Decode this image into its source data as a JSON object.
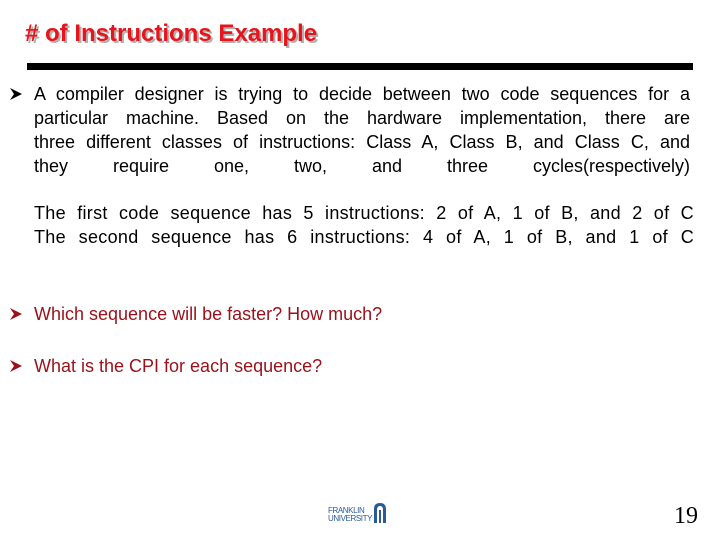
{
  "slide": {
    "title": "# of Instructions Example",
    "colors": {
      "title": "#e8141c",
      "body": "#000000",
      "questions": "#9b1019",
      "rule": "#000000",
      "logo": "#2a5a9a"
    },
    "intro_bullet": {
      "icon": "arrowhead-bullet-icon",
      "lines": [
        "A compiler designer is trying to decide between two code sequences for a",
        "particular machine.  Based on the hardware implementation, there are",
        "three different classes of instructions:  Class A, Class B, and Class C, and",
        "they require one, two, and three cycles(respectively)"
      ]
    },
    "sequences": [
      "The first code sequence has 5 instructions:  2 of A, 1 of B, and 2 of C",
      "The second sequence has 6 instructions:  4 of A, 1 of B, and 1 of C"
    ],
    "questions": [
      {
        "icon": "arrowhead-bullet-icon",
        "text": "Which sequence will be faster?  How much?"
      },
      {
        "icon": "arrowhead-bullet-icon",
        "text": "What is the CPI for each sequence?"
      }
    ],
    "footer": {
      "logo_line1": "FRANKLIN",
      "logo_line2": "UNIVERSITY",
      "logo_icon": "franklin-university-logo-icon",
      "page_number": "19"
    }
  }
}
